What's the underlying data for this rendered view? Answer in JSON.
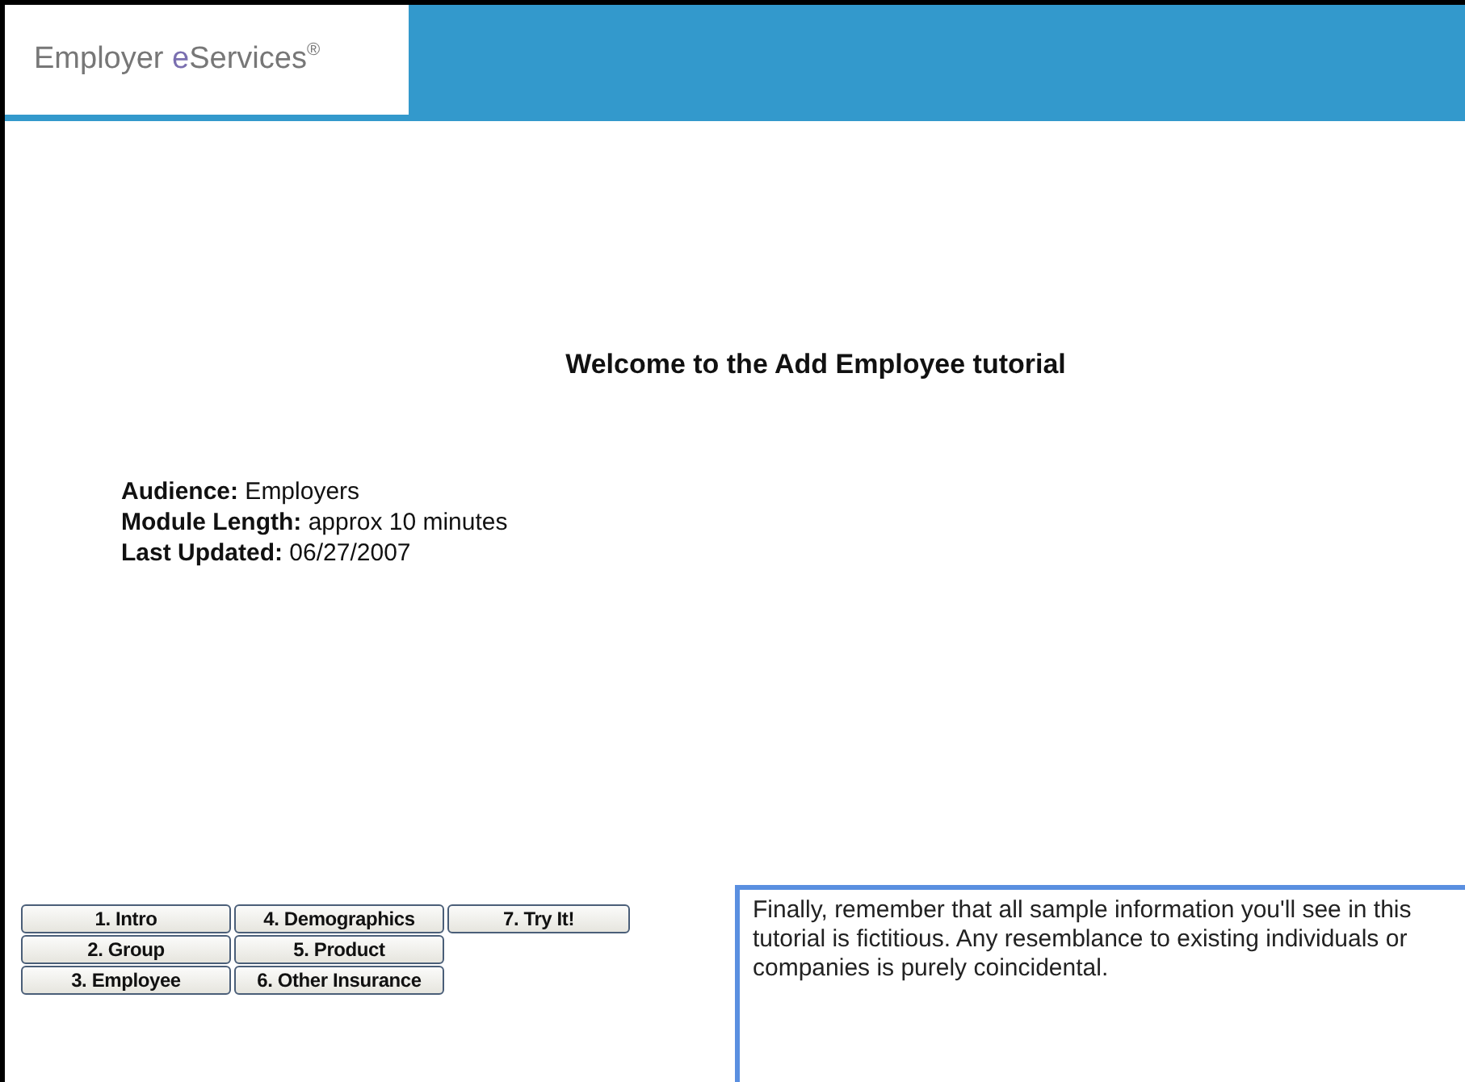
{
  "header": {
    "logo": [
      {
        "text": "Employer ",
        "kind": "plain"
      },
      {
        "text": "e",
        "kind": "accent"
      },
      {
        "text": "Services",
        "kind": "plain"
      },
      {
        "text": "®",
        "kind": "sup"
      }
    ]
  },
  "title": "Welcome to the Add Employee tutorial",
  "info": [
    "**Audience:** Employers",
    "**Module Length:** approx 10 minutes",
    "**Last Updated:** 06/27/2007"
  ],
  "nav_buttons": [
    "1. Intro",
    "2. Group",
    "3. Employee",
    "4. Demographics",
    "5. Product",
    "6. Other Insurance",
    "7. Try It!"
  ],
  "caption": "Finally, remember that all sample information you'll see in this tutorial is fictitious.  Any resemblance to existing individuals or companies is purely coincidental."
}
